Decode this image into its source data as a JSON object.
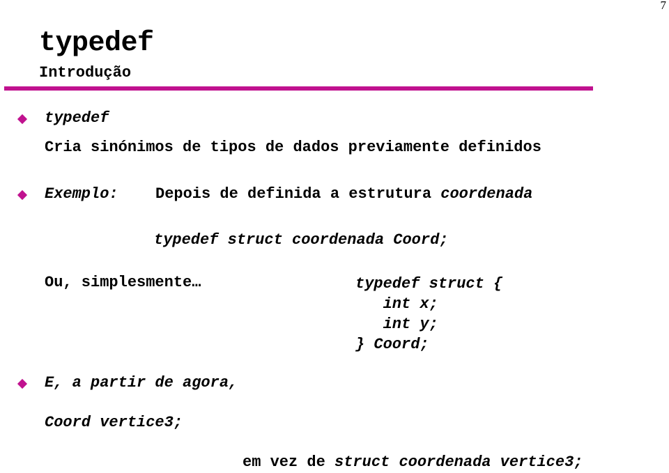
{
  "page_number": "7",
  "header": {
    "title": "typedef",
    "subtitle": "Introdução"
  },
  "colors": {
    "accent": "#c0128f"
  },
  "bullets": [
    {
      "icon": "diamond-bullet-icon",
      "label": "typedef",
      "text": "Cria sinónimos de tipos de dados previamente definidos"
    },
    {
      "icon": "diamond-bullet-icon",
      "label": "Exemplo:",
      "text_plain": "Depois de definida a estrutura ",
      "text_italic": "coordenada",
      "code": "typedef struct coordenada Coord;"
    },
    {
      "icon": "diamond-bullet-icon",
      "label": "E, a partir de agora,",
      "code": "Coord vertice3;"
    }
  ],
  "alternative": {
    "label": "Ou, simplesmente…",
    "code_lines": [
      "typedef struct {",
      "   int x;",
      "   int y;",
      "} Coord;"
    ]
  },
  "footer": {
    "plain": "em vez de ",
    "code": "struct coordenada vertice3;"
  }
}
